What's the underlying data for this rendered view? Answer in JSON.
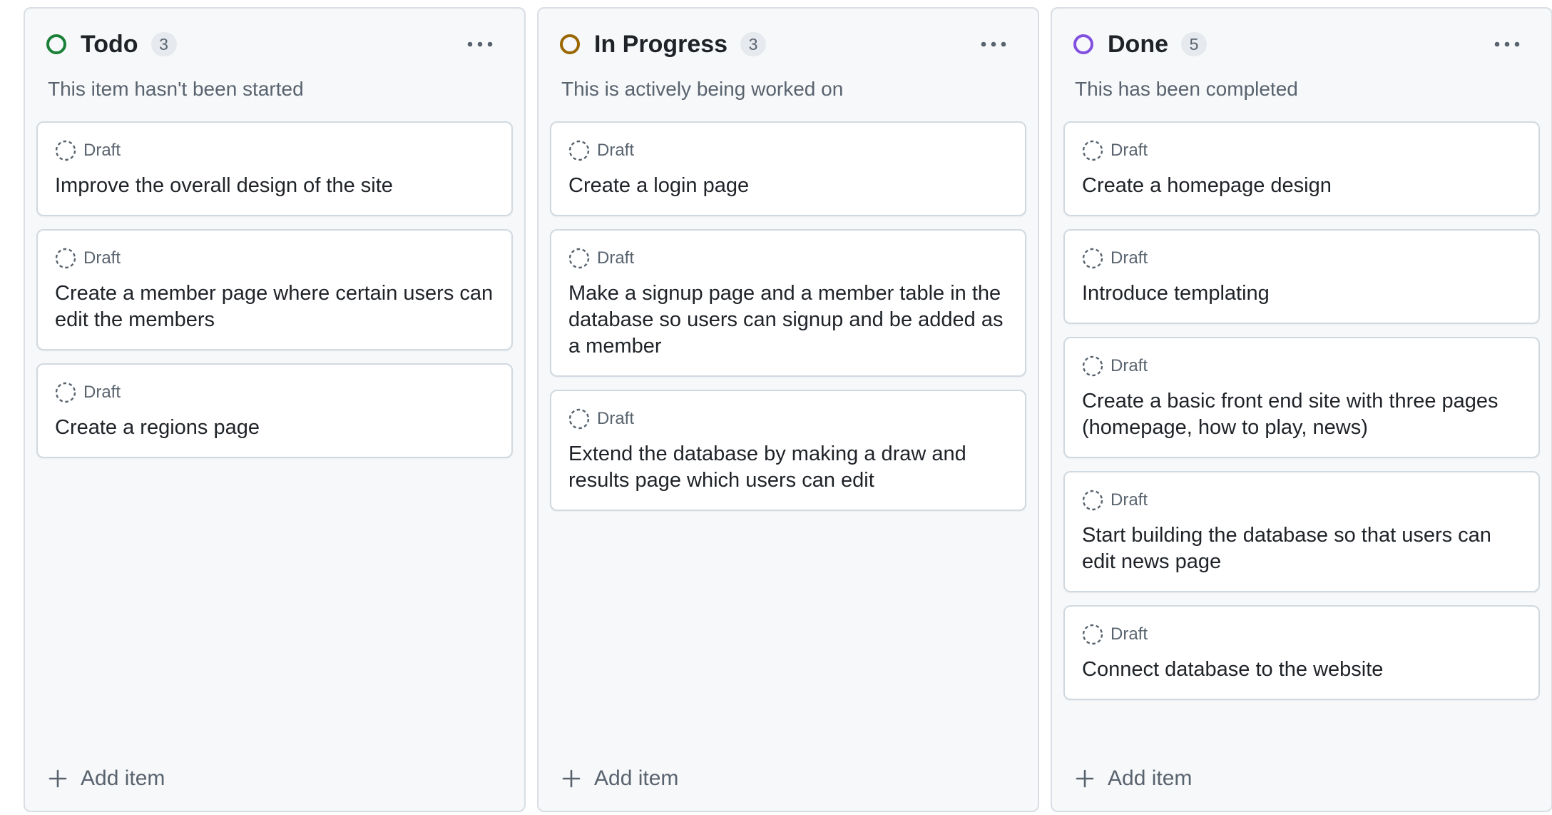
{
  "columns": [
    {
      "title": "Todo",
      "count": "3",
      "description": "This item hasn't been started",
      "status_color": "#1a7f37",
      "status_icon": "green-circle-icon",
      "add_label": "Add item",
      "cards": [
        {
          "type": "Draft",
          "title": "Improve the overall design of the site"
        },
        {
          "type": "Draft",
          "title": "Create a member page where certain users can edit the members"
        },
        {
          "type": "Draft",
          "title": "Create a regions page"
        }
      ]
    },
    {
      "title": "In Progress",
      "count": "3",
      "description": "This is actively being worked on",
      "status_color": "#9a6700",
      "status_icon": "yellow-circle-icon",
      "add_label": "Add item",
      "cards": [
        {
          "type": "Draft",
          "title": "Create a login page"
        },
        {
          "type": "Draft",
          "title": "Make a signup page and a member table in the database so users can signup and be added as a member"
        },
        {
          "type": "Draft",
          "title": "Extend the database by making a draw and results page which users can edit"
        }
      ]
    },
    {
      "title": "Done",
      "count": "5",
      "description": "This has been completed",
      "status_color": "#8250df",
      "status_icon": "purple-circle-icon",
      "add_label": "Add item",
      "cards": [
        {
          "type": "Draft",
          "title": "Create a homepage design"
        },
        {
          "type": "Draft",
          "title": "Introduce templating"
        },
        {
          "type": "Draft",
          "title": "Create a basic front end site with three pages (homepage, how to play, news)"
        },
        {
          "type": "Draft",
          "title": "Start building the database so that users can edit news page"
        },
        {
          "type": "Draft",
          "title": "Connect database to the website"
        }
      ]
    }
  ]
}
